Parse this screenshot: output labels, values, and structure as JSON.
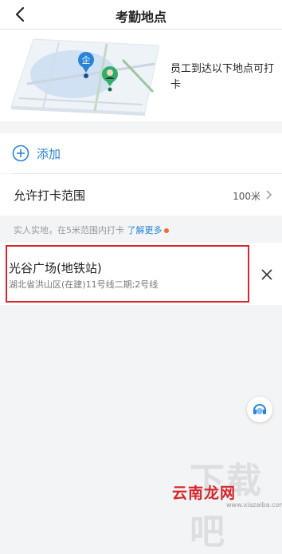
{
  "header": {
    "title": "考勤地点"
  },
  "banner": {
    "text": "员工到达以下地点可打卡",
    "map_pin_label": "企",
    "map_street_labels": [
      "",
      "",
      ""
    ]
  },
  "add": {
    "label": "添加"
  },
  "range": {
    "label": "允许打卡范围",
    "value": "100米"
  },
  "hint": {
    "text": "实人实地，在5米范围内打卡 ",
    "link": "了解更多"
  },
  "location": {
    "name": "光谷广场(地铁站)",
    "address": "湖北省洪山区(在建)11号线二期;2号线"
  },
  "watermark": {
    "big": "下载吧",
    "brand": "云南龙网",
    "url": "www.xiazaiba.com"
  },
  "colors": {
    "accent": "#2a83d6",
    "highlight": "#d8262f",
    "dot": "#f06a35"
  }
}
